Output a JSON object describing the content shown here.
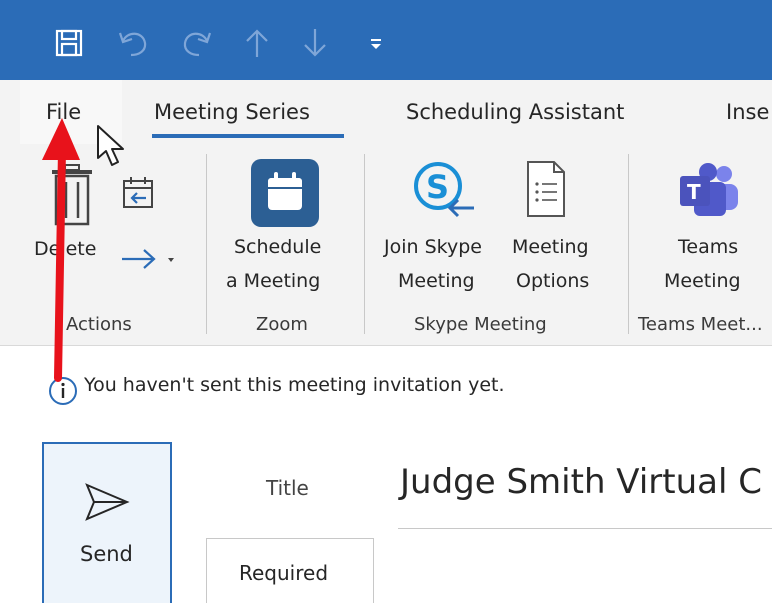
{
  "quick_access": {
    "items": [
      "save-icon",
      "undo-icon",
      "redo-icon",
      "up-arrow-icon",
      "down-arrow-icon",
      "customize-icon"
    ]
  },
  "tabs": {
    "file": "File",
    "meeting_series": "Meeting Series",
    "scheduling_assistant": "Scheduling Assistant",
    "insert_partial": "Inse"
  },
  "ribbon": {
    "actions": {
      "delete_label": "Delete",
      "group_label": "Actions"
    },
    "zoom": {
      "schedule_line1": "Schedule",
      "schedule_line2": "a Meeting",
      "group_label": "Zoom"
    },
    "skype": {
      "join_line1": "Join Skype",
      "join_line2": "Meeting",
      "options_line1": "Meeting",
      "options_line2": "Options",
      "group_label": "Skype Meeting"
    },
    "teams": {
      "teams_line1": "Teams",
      "teams_line2": "Meeting",
      "group_label": "Teams Meet..."
    }
  },
  "info": {
    "message": "You haven't sent this meeting invitation yet."
  },
  "compose": {
    "send_label": "Send",
    "title_label": "Title",
    "title_value": "Judge Smith Virtual C",
    "required_label": "Required"
  },
  "colors": {
    "accent": "#2b6cb7",
    "annotation_arrow": "#e8121b",
    "ribbon_bg": "#f3f3f3"
  }
}
